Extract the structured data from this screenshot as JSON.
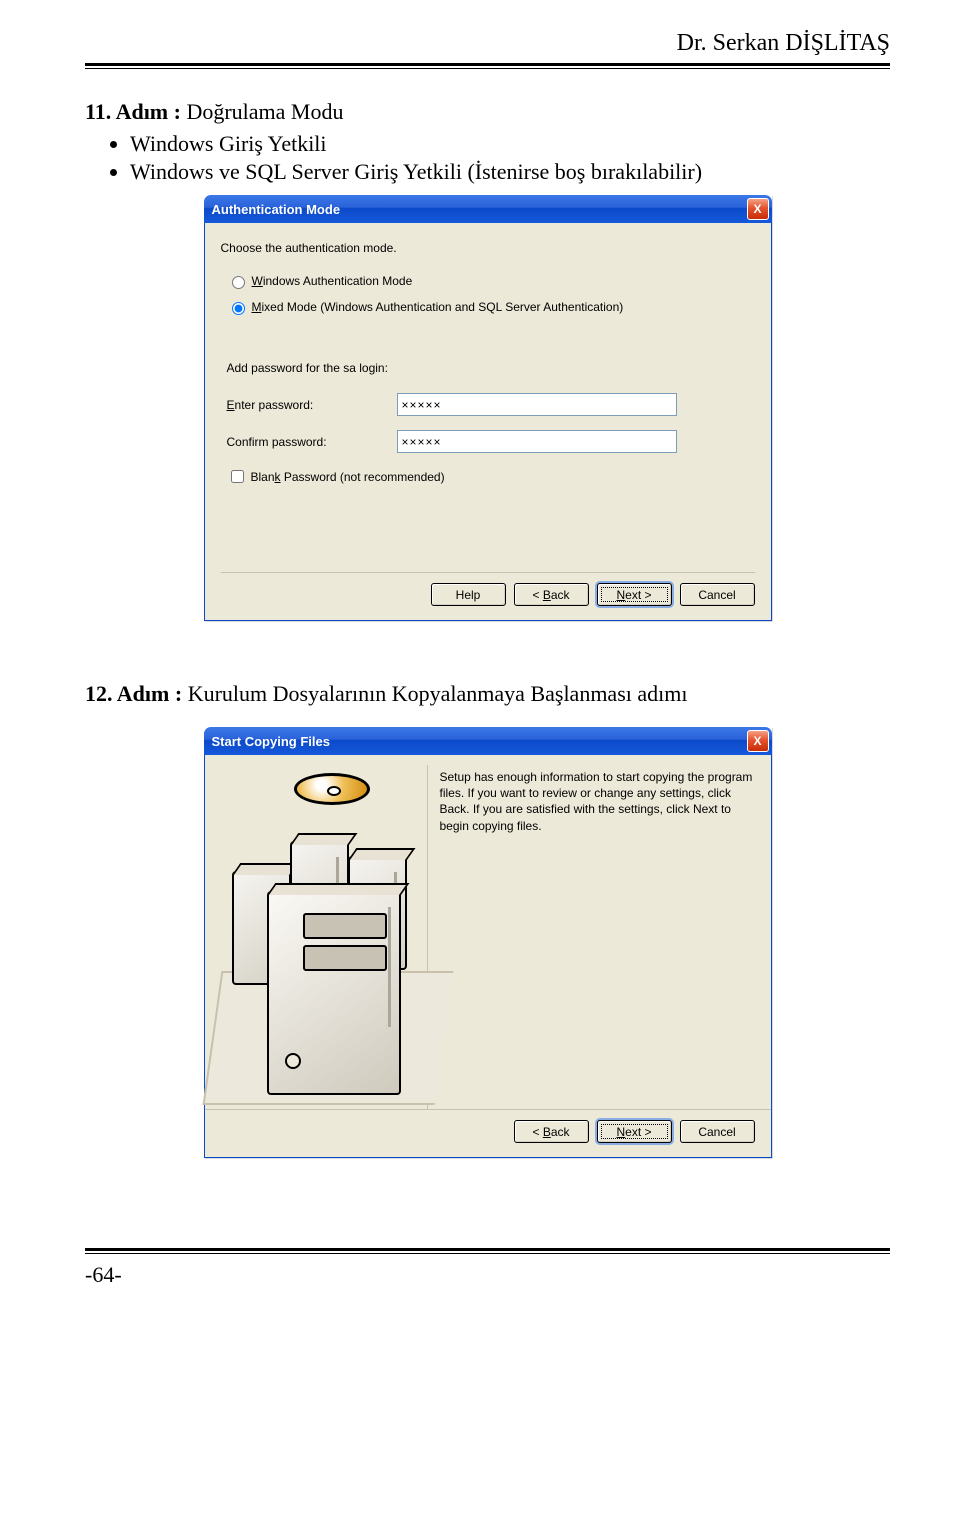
{
  "header": {
    "author": "Dr. Serkan DİŞLİTAŞ"
  },
  "step11": {
    "title_label": "11. Adım :",
    "title_rest": " Doğrulama Modu",
    "bullets": [
      "Windows Giriş Yetkili",
      "Windows ve SQL Server Giriş Yetkili (İstenirse boş bırakılabilir)"
    ]
  },
  "dialog1": {
    "title": "Authentication Mode",
    "close": "X",
    "prompt": "Choose the authentication mode.",
    "opt_windows_pre": "W",
    "opt_windows_rest": "indows Authentication Mode",
    "opt_mixed_pre": "M",
    "opt_mixed_rest": "ixed Mode (Windows Authentication and SQL Server Authentication)",
    "opt_windows_checked": false,
    "opt_mixed_checked": true,
    "add_pw_prompt": "Add password for the sa login:",
    "enter_pw_pre": "E",
    "enter_pw_rest": "nter password:",
    "enter_pw_value": "×××××",
    "confirm_pw_label": "Confirm password:",
    "confirm_pw_value": "×××××",
    "blank_pw_pre": "Blan",
    "blank_pw_u": "k",
    "blank_pw_rest": " Password (not recommended)",
    "blank_pw_checked": false,
    "buttons": {
      "help": "Help",
      "back_pre": "< ",
      "back_u": "B",
      "back_rest": "ack",
      "next_u": "N",
      "next_rest": "ext >",
      "cancel": "Cancel"
    }
  },
  "step12": {
    "title_label": "12. Adım :",
    "title_rest": " Kurulum Dosyalarının Kopyalanmaya Başlanması adımı"
  },
  "dialog2": {
    "title": "Start Copying Files",
    "close": "X",
    "body_text": "Setup has enough information to start copying the program files. If you want to review or change any settings, click Back. If you are satisfied with the settings, click Next to begin copying files.",
    "buttons": {
      "back_pre": "< ",
      "back_u": "B",
      "back_rest": "ack",
      "next_u": "N",
      "next_rest": "ext >",
      "cancel": "Cancel"
    }
  },
  "footer": {
    "page_number": "-64-"
  }
}
